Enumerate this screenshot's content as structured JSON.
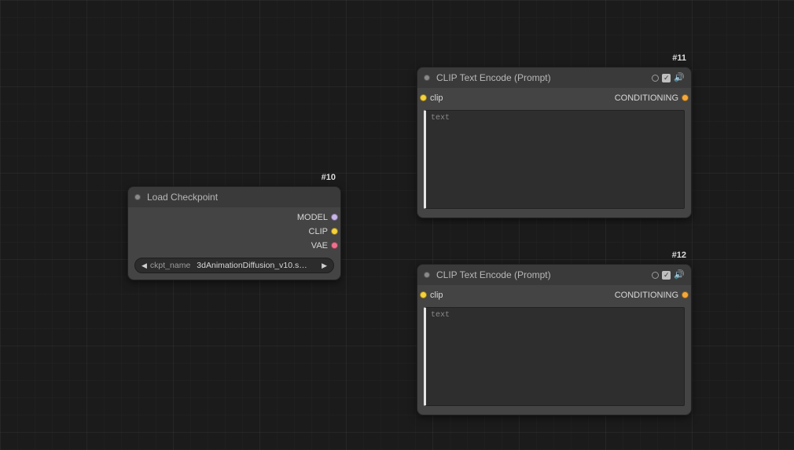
{
  "nodes": {
    "load_checkpoint": {
      "id": "#10",
      "title": "Load Checkpoint",
      "outputs": {
        "model": "MODEL",
        "clip": "CLIP",
        "vae": "VAE"
      },
      "widget": {
        "name": "ckpt_name",
        "value": "3dAnimationDiffusion_v10.s…"
      }
    },
    "clip_encode_a": {
      "id": "#11",
      "title": "CLIP Text Encode (Prompt)",
      "inputs": {
        "clip": "clip"
      },
      "outputs": {
        "conditioning": "CONDITIONING"
      },
      "text_value": "",
      "text_placeholder": "text"
    },
    "clip_encode_b": {
      "id": "#12",
      "title": "CLIP Text Encode (Prompt)",
      "inputs": {
        "clip": "clip"
      },
      "outputs": {
        "conditioning": "CONDITIONING"
      },
      "text_value": "",
      "text_placeholder": "text"
    }
  },
  "glyphs": {
    "arrow_left": "◀",
    "arrow_right": "▶",
    "check": "✓",
    "sound": "🔊"
  }
}
